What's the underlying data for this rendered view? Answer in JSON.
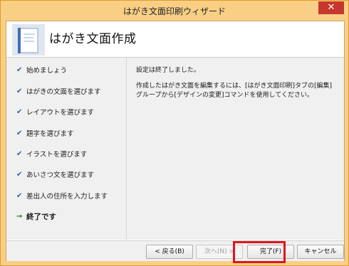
{
  "window": {
    "title": "はがき文面印刷ウィザード",
    "close_label": "✕"
  },
  "header": {
    "title": "はがき文面作成",
    "icon": "postcard-icon"
  },
  "steps": [
    {
      "label": "始めましょう",
      "icon": "checkmark-icon",
      "mark": "✔"
    },
    {
      "label": "はがきの文面を選びます",
      "icon": "checkmark-icon",
      "mark": "✔"
    },
    {
      "label": "レイアウトを選びます",
      "icon": "checkmark-icon",
      "mark": "✔"
    },
    {
      "label": "題字を選びます",
      "icon": "checkmark-icon",
      "mark": "✔"
    },
    {
      "label": "イラストを選びます",
      "icon": "checkmark-icon",
      "mark": "✔"
    },
    {
      "label": "あいさつ文を選びます",
      "icon": "checkmark-icon",
      "mark": "✔"
    },
    {
      "label": "差出人の住所を入力します",
      "icon": "checkmark-icon",
      "mark": "✔"
    },
    {
      "label": "終了です",
      "icon": "arrow-right-icon",
      "mark": "→"
    }
  ],
  "content": {
    "line1": "設定は終了しました。",
    "line2": "作成したはがき文面を編集するには、[はがき文面印刷]タブの[編集]グループから[デザインの変更]コマンドを使用してください。"
  },
  "buttons": {
    "back": "< 戻る(B)",
    "next": "次へ(N) >",
    "finish": "完了(F)",
    "cancel": "キャンセル"
  },
  "colors": {
    "titlebar": "#f9cf86",
    "close": "#c7372f",
    "highlight": "#e0161a",
    "check": "#2f5ea8"
  }
}
